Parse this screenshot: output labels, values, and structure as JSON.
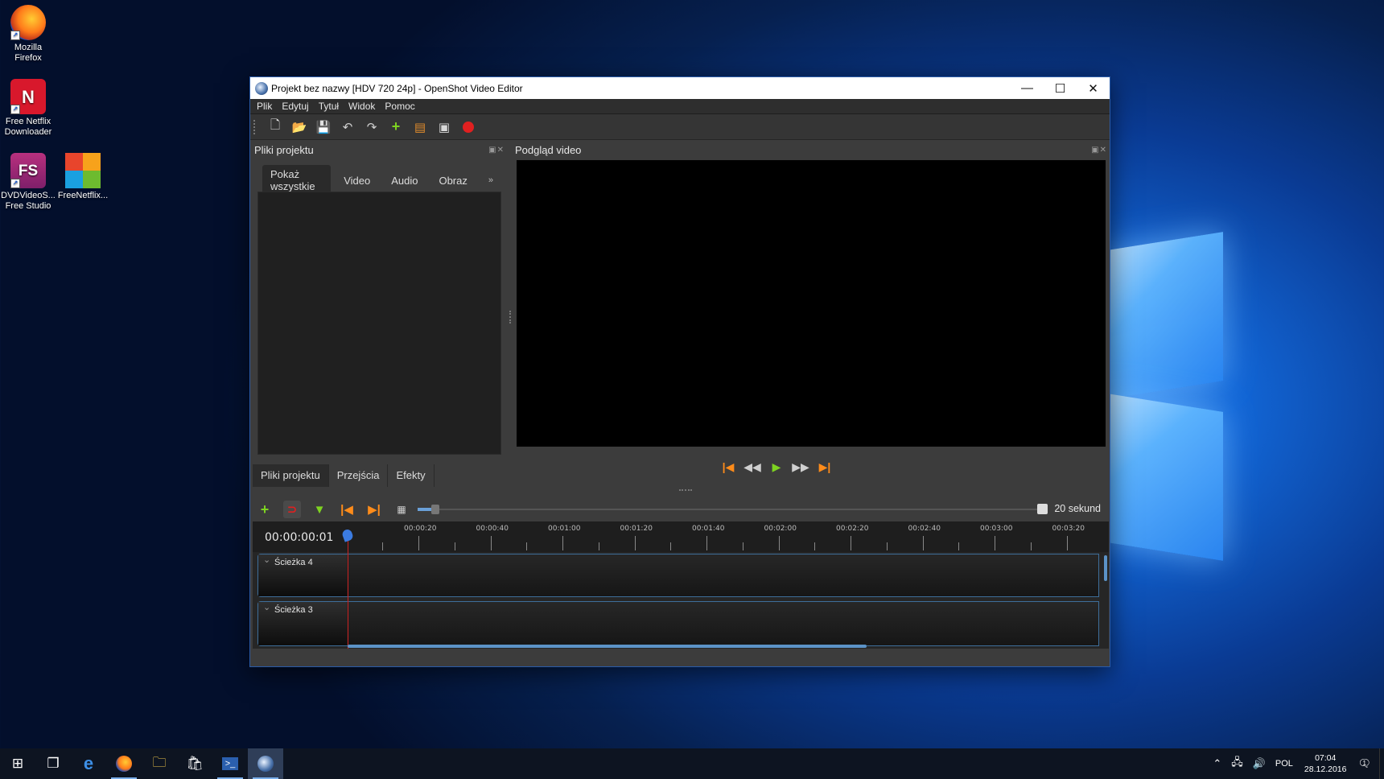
{
  "desktop": {
    "icons": [
      {
        "label_line1": "Mozilla",
        "label_line2": "Firefox",
        "icon": "firefox-icon"
      },
      {
        "label_line1": "Free Netflix",
        "label_line2": "Downloader",
        "icon": "netflix-downloader-icon",
        "glyph": "N"
      },
      {
        "label_line1": "DVDVideoS...",
        "label_line2": "Free Studio",
        "icon": "dvdvideosoft-icon",
        "glyph": "FS"
      },
      {
        "label_line1": "FreeNetflix...",
        "label_line2": "",
        "icon": "freenetflix-icon"
      }
    ]
  },
  "window": {
    "title": "Projekt bez nazwy [HDV 720 24p] - OpenShot Video Editor",
    "controls": {
      "minimize": "—",
      "maximize": "☐",
      "close": "✕"
    },
    "menu": [
      "Plik",
      "Edytuj",
      "Tytuł",
      "Widok",
      "Pomoc"
    ]
  },
  "project_panel": {
    "title": "Pliki projektu",
    "dock_controls": "▣✕",
    "filters": [
      "Pokaż wszystkie",
      "Video",
      "Audio",
      "Obraz"
    ],
    "more": "»",
    "bottom_tabs": [
      "Pliki projektu",
      "Przejścia",
      "Efekty"
    ]
  },
  "preview_panel": {
    "title": "Podgląd video",
    "dock_controls": "▣✕"
  },
  "timeline": {
    "timecode": "00:00:00:01",
    "zoom_label": "20 sekund",
    "ticks": [
      "00:00:20",
      "00:00:40",
      "00:01:00",
      "00:01:20",
      "00:01:40",
      "00:02:00",
      "00:02:20",
      "00:02:40",
      "00:03:00",
      "00:03:20"
    ],
    "tracks": [
      "Ścieżka 4",
      "Ścieżka 3"
    ]
  },
  "taskbar": {
    "lang": "POL",
    "time": "07:04",
    "date": "28.12.2016",
    "notifications": "1"
  },
  "colors": {
    "play_green": "#7ed321",
    "skip_orange": "#ff8c1a",
    "record_red": "#e02020"
  }
}
